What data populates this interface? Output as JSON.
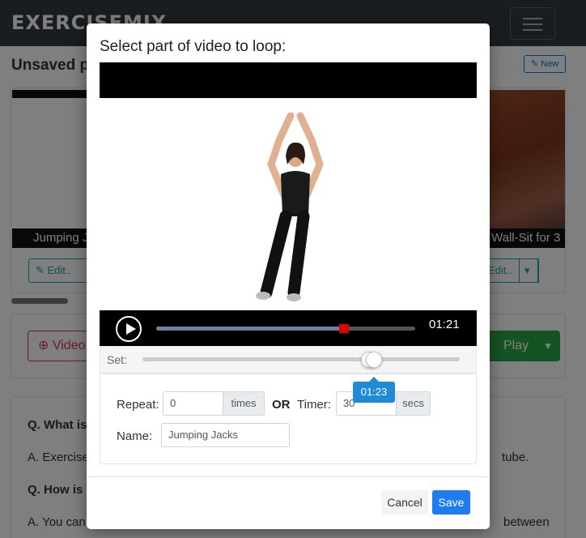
{
  "navbar": {
    "brand": "EXERCISEMIX"
  },
  "page": {
    "title": "Unsaved p",
    "new_label": "New"
  },
  "workouts": {
    "left_caption": "Jumping J",
    "right_caption": "Wall-Sit for 3",
    "edit_label": "Edit.."
  },
  "controls": {
    "video_label": "Video",
    "play_label": "Play"
  },
  "faq": {
    "q1": "Q. What is",
    "a1_start": "A. Exercise",
    "a1_end": "tube.",
    "q2": "Q. How is",
    "a2_start": "A. You can",
    "a2_end": "between"
  },
  "modal": {
    "title": "Select part of video to loop:",
    "player": {
      "current_time": "01:21",
      "progress_percent": 72
    },
    "set_slider": {
      "label": "Set:",
      "value_label": "01:23",
      "position_percent": 73
    },
    "form": {
      "repeat_label": "Repeat:",
      "repeat_value": "0",
      "repeat_unit": "times",
      "or_label": "OR",
      "timer_label": "Timer:",
      "timer_value": "30",
      "timer_unit": "secs",
      "name_label": "Name:",
      "name_value": "Jumping Jacks"
    },
    "cancel_label": "Cancel",
    "save_label": "Save"
  },
  "colors": {
    "save": "#1e7bf0",
    "play": "#28a745",
    "video": "#dc3545",
    "edit": "#17a2b8"
  }
}
